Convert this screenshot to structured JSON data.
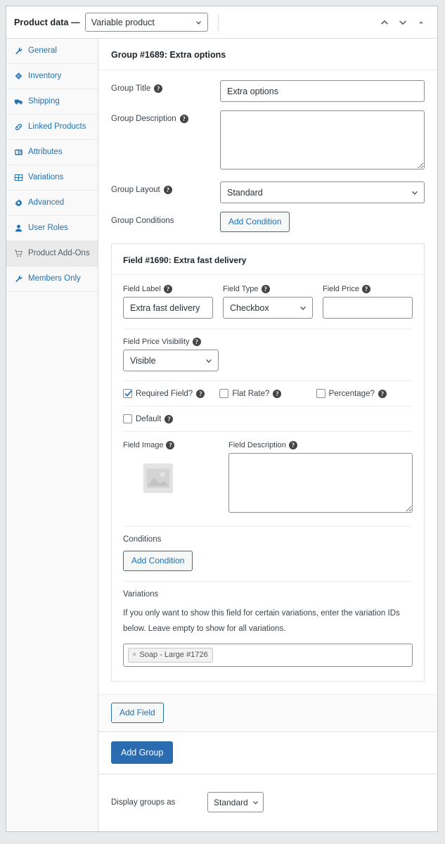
{
  "header": {
    "title": "Product data —",
    "product_type": "Variable product",
    "icons": {
      "chevron_up": "chevron-up-icon",
      "chevron_down": "chevron-down-icon",
      "toggle": "triangle-up-icon"
    }
  },
  "sidebar": {
    "items": [
      {
        "label": "General",
        "icon": "wrench-icon",
        "active": false
      },
      {
        "label": "Inventory",
        "icon": "archive-icon",
        "active": false
      },
      {
        "label": "Shipping",
        "icon": "truck-icon",
        "active": false
      },
      {
        "label": "Linked Products",
        "icon": "link-icon",
        "active": false
      },
      {
        "label": "Attributes",
        "icon": "attributes-icon",
        "active": false
      },
      {
        "label": "Variations",
        "icon": "grid-icon",
        "active": false
      },
      {
        "label": "Advanced",
        "icon": "gear-icon",
        "active": false
      },
      {
        "label": "User Roles",
        "icon": "user-icon",
        "active": false
      },
      {
        "label": "Product Add-Ons",
        "icon": "cart-icon",
        "active": true
      },
      {
        "label": "Members Only",
        "icon": "wrench-icon",
        "active": false
      }
    ]
  },
  "group": {
    "heading": "Group #1689: Extra options",
    "title_label": "Group Title",
    "title_value": "Extra options",
    "description_label": "Group Description",
    "description_value": "",
    "layout_label": "Group Layout",
    "layout_value": "Standard",
    "conditions_label": "Group Conditions",
    "add_condition_label": "Add Condition"
  },
  "field": {
    "heading": "Field #1690: Extra fast delivery",
    "label_label": "Field Label",
    "label_value": "Extra fast delivery",
    "type_label": "Field Type",
    "type_value": "Checkbox",
    "price_label": "Field Price",
    "price_value": "",
    "price_visibility_label": "Field Price Visibility",
    "price_visibility_value": "Visible",
    "checkboxes": [
      {
        "label": "Required Field?",
        "checked": true
      },
      {
        "label": "Flat Rate?",
        "checked": false
      },
      {
        "label": "Percentage?",
        "checked": false
      }
    ],
    "default_checkbox": {
      "label": "Default",
      "checked": false
    },
    "image_label": "Field Image",
    "description_label": "Field Description",
    "description_value": "",
    "conditions_label": "Conditions",
    "add_condition_label": "Add Condition",
    "variations_label": "Variations",
    "variations_help": "If you only want to show this field for certain variations, enter the variation IDs below. Leave empty to show for all variations.",
    "variation_tags": [
      {
        "remove": "×",
        "label": "Soap - Large #1726"
      }
    ]
  },
  "footer": {
    "add_field_label": "Add Field",
    "add_group_label": "Add Group",
    "display_groups_label": "Display groups as",
    "display_groups_value": "Standard"
  },
  "colors": {
    "link": "#2271b1",
    "primary_button": "#2b6cb0",
    "page_background": "#e8e9ea",
    "sidebar_background": "#f9f9f9",
    "active_tab_background": "#eaeaea"
  }
}
